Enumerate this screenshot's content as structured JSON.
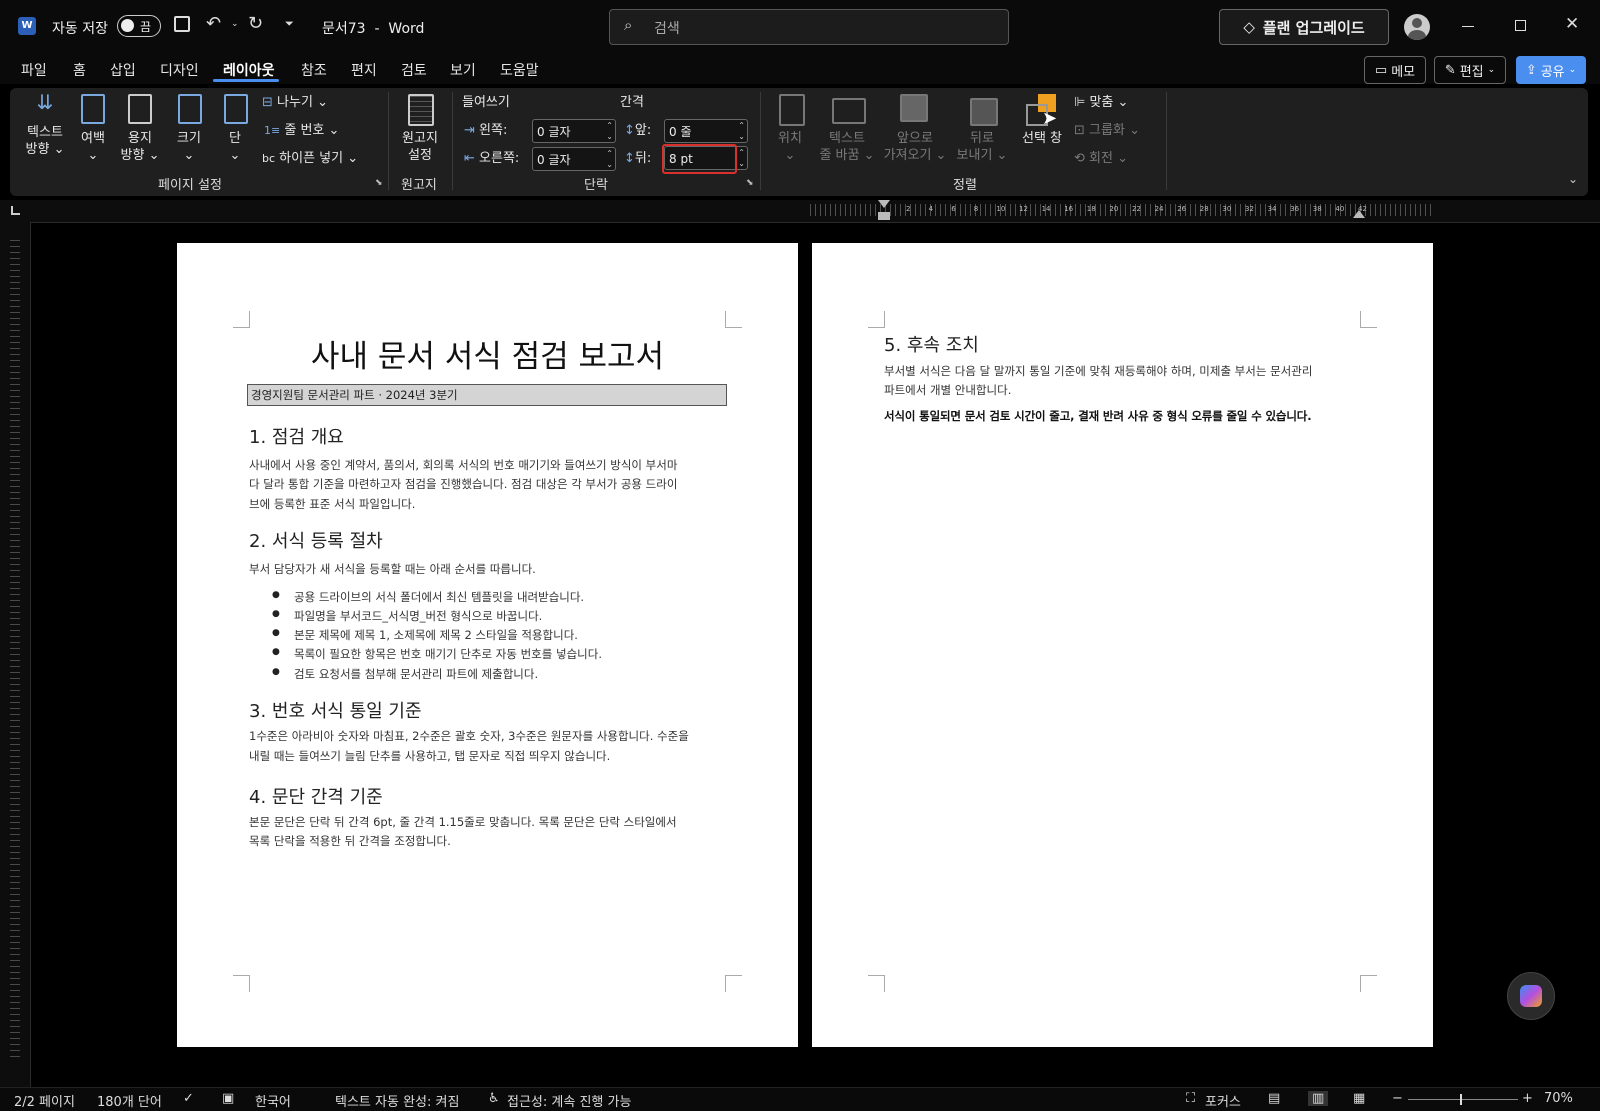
{
  "titlebar": {
    "app_icon": "word-app-icon",
    "autosave_label": "자동 저장",
    "autosave_state": "끔",
    "doc_title": "문서73  -  Word",
    "search_placeholder": "검색",
    "upgrade_label": "플랜 업그레이드"
  },
  "tabs": [
    "파일",
    "홈",
    "삽입",
    "디자인",
    "레이아웃",
    "참조",
    "편지",
    "검토",
    "보기",
    "도움말"
  ],
  "active_tab": "레이아웃",
  "right_buttons": {
    "memo": "메모",
    "edit": "편집",
    "share": "공유"
  },
  "ribbon": {
    "page_setup": {
      "text_direction": [
        "텍스트",
        "방향"
      ],
      "margins": "여백",
      "orientation": [
        "용지",
        "방향"
      ],
      "size": "크기",
      "columns": "단",
      "breaks": "나누기",
      "line_numbers": "줄 번호",
      "hyphenation": "하이픈 넣기",
      "label": "페이지 설정"
    },
    "manuscript": {
      "button": [
        "원고지",
        "설정"
      ],
      "label": "원고지"
    },
    "paragraph": {
      "indent_header": "들여쓰기",
      "spacing_header": "간격",
      "left_label": "왼쪽:",
      "left_value": "0 글자",
      "right_label": "오른쪽:",
      "right_value": "0 글자",
      "before_label": "앞:",
      "before_value": "0 줄",
      "after_label": "뒤:",
      "after_value": "8 pt",
      "label": "단락"
    },
    "arrange": {
      "position": "위치",
      "wrap_text": [
        "텍스트",
        "줄 바꿈"
      ],
      "bring_forward": [
        "앞으로",
        "가져오기"
      ],
      "send_backward": [
        "뒤로",
        "보내기"
      ],
      "selection_pane": "선택 창",
      "align": "맞춤",
      "group": "그룹화",
      "rotate": "회전",
      "label": "정렬"
    }
  },
  "hruler_ticks": [
    "2",
    "4",
    "6",
    "8",
    "10",
    "12",
    "14",
    "16",
    "18",
    "20",
    "22",
    "24",
    "26",
    "28",
    "30",
    "32",
    "34",
    "36",
    "38",
    "40",
    "42"
  ],
  "document": {
    "page1": {
      "title": "사내 문서 서식 점검 보고서",
      "subtitle": "경영지원팀 문서관리 파트 · 2024년 3분기",
      "s1_heading": "1. 점검 개요",
      "s1_body_1": "사내에서 사용 중인 계약서, 품의서, 회의록 서식의 번호 매기기와 들여쓰기 방식이 부서마",
      "s1_body_2": "다 달라 통합 기준을 마련하고자 점검을 진행했습니다. 점검 대상은 각 부서가 공용 드라이",
      "s1_body_3": "브에 등록한 표준 서식 파일입니다.",
      "s2_heading": "2. 서식 등록 절차",
      "s2_body": "부서 담당자가 새 서식을 등록할 때는 아래 순서를 따릅니다.",
      "bullets": [
        "공용 드라이브의 서식 폴더에서 최신 템플릿을 내려받습니다.",
        "파일명을 부서코드_서식명_버전 형식으로 바꿉니다.",
        "본문 제목에 제목 1, 소제목에 제목 2 스타일을 적용합니다.",
        "목록이 필요한 항목은 번호 매기기 단추로 자동 번호를 넣습니다.",
        "검토 요청서를 첨부해 문서관리 파트에 제출합니다."
      ],
      "s3_heading": "3. 번호 서식 통일 기준",
      "s3_body_1": "1수준은 아라비아 숫자와 마침표, 2수준은 괄호 숫자, 3수준은 원문자를 사용합니다. 수준을",
      "s3_body_2": "내릴 때는 들여쓰기 늘림 단추를 사용하고, 탭 문자로 직접 띄우지 않습니다.",
      "s4_heading": "4. 문단 간격 기준",
      "s4_body_1": "본문 문단은 단락 뒤 간격 6pt, 줄 간격 1.15줄로 맞춥니다. 목록 문단은 단락 스타일에서",
      "s4_body_2": "목록 단락을 적용한 뒤 간격을 조정합니다."
    },
    "page2": {
      "s5_heading": "5. 후속 조치",
      "s5_body_1": "부서별 서식은 다음 달 말까지 통일 기준에 맞춰 재등록해야 하며, 미제출 부서는 문서관리",
      "s5_body_2": "파트에서 개별 안내합니다.",
      "s5_bold": "서식이 통일되면 문서 검토 시간이 줄고, 결재 반려 사유 중 형식 오류를 줄일 수 있습니다."
    }
  },
  "statusbar": {
    "page": "2/2 페이지",
    "words": "180개 단어",
    "language": "한국어",
    "autocomplete": "텍스트 자동 완성: 켜짐",
    "accessibility": "접근성: 계속 진행 가능",
    "focus": "포커스",
    "zoom": "70%"
  },
  "colors": {
    "accent": "#4a8ef0",
    "highlight_box": "#d9302c",
    "share_button": "#4a8ef0"
  }
}
